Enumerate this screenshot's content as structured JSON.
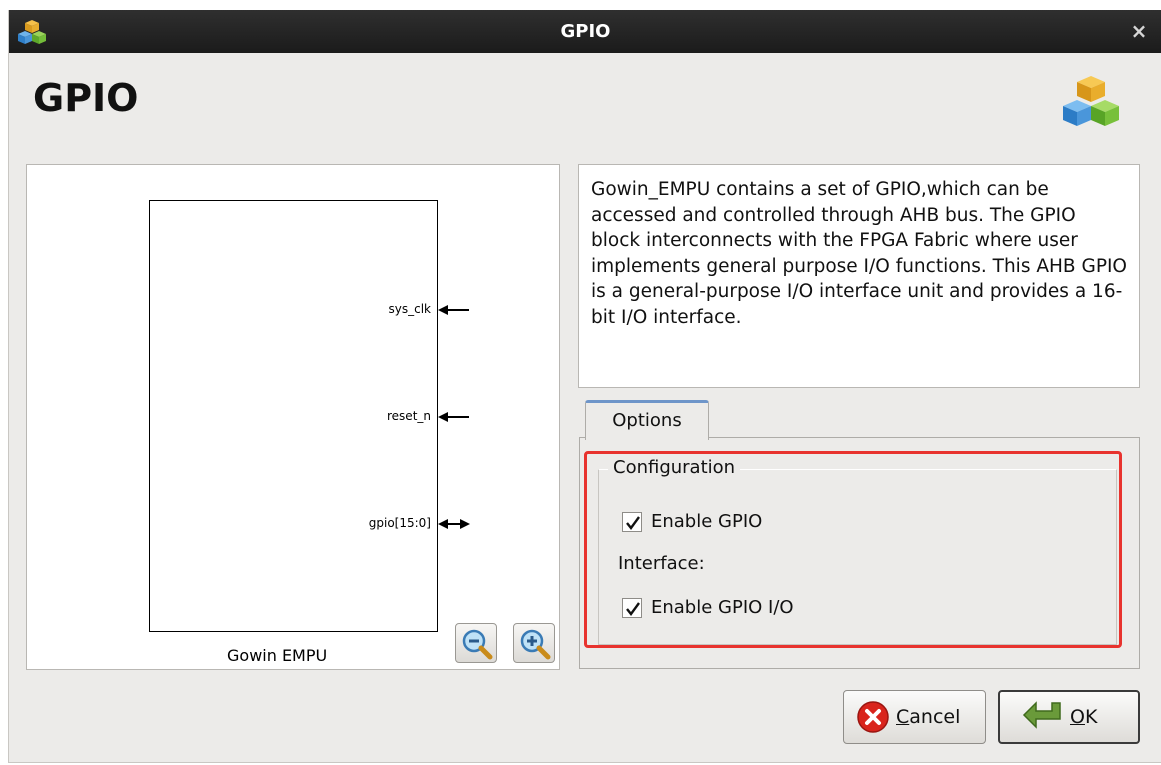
{
  "window": {
    "title": "GPIO",
    "close_glyph": "×",
    "icon": "cube-stack-icon"
  },
  "header": {
    "title": "GPIO",
    "icon": "cube-stack-icon"
  },
  "diagram": {
    "block_name": "Gowin EMPU",
    "ports": [
      {
        "label": "sys_clk",
        "direction": "input"
      },
      {
        "label": "reset_n",
        "direction": "input"
      },
      {
        "label": "gpio[15:0]",
        "direction": "inout"
      }
    ],
    "zoom_out_icon": "zoom-out-icon",
    "zoom_in_icon": "zoom-in-icon"
  },
  "description": "Gowin_EMPU contains a set of GPIO,which can be accessed and controlled through AHB bus. The GPIO block interconnects with the FPGA Fabric where user implements general purpose I/O functions. This AHB GPIO is a general-purpose I/O interface unit and provides a 16-bit I/O interface.",
  "tabs": [
    {
      "label": "Options",
      "active": true
    }
  ],
  "configuration": {
    "group_title": "Configuration",
    "enable_gpio": {
      "label": "Enable GPIO",
      "checked": true
    },
    "interface_label": "Interface:",
    "enable_gpio_io": {
      "label": "Enable GPIO I/O",
      "checked": true
    }
  },
  "buttons": {
    "cancel": {
      "label": "Cancel",
      "icon": "cancel-x-icon"
    },
    "ok": {
      "label": "OK",
      "icon": "ok-arrow-icon"
    }
  },
  "colors": {
    "highlight": "#e8332e",
    "titlebar": "#1b1b1b",
    "window_bg": "#ecebe9",
    "tab_accent": "#6e95c9"
  }
}
